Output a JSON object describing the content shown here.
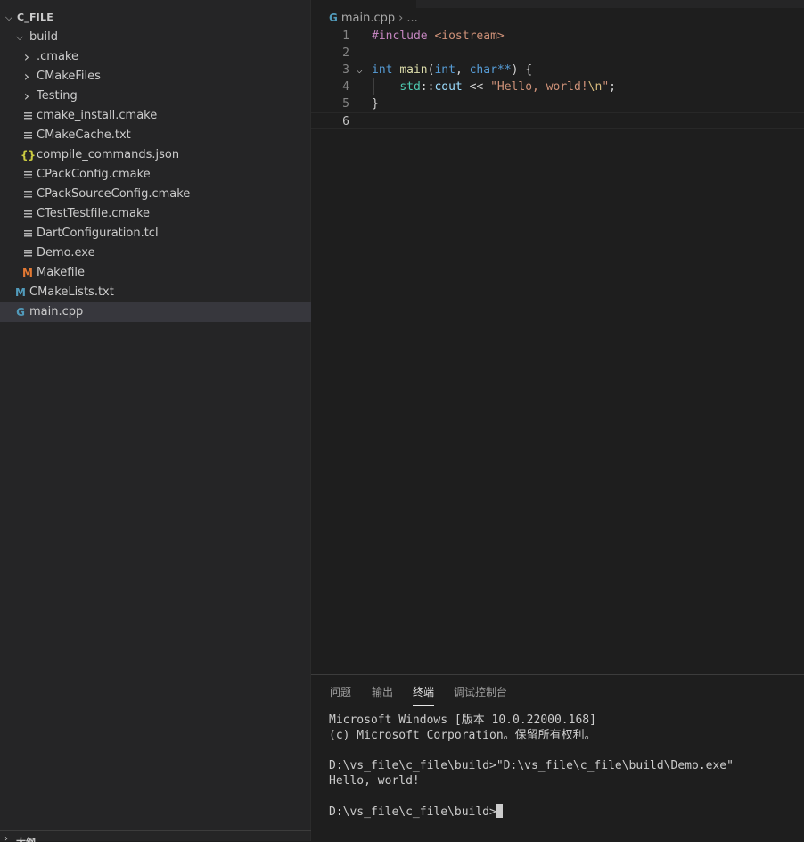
{
  "explorer": {
    "root": {
      "label": "C_FILE",
      "expanded": true
    },
    "items": [
      {
        "label": "build",
        "depth": 1,
        "kind": "folder",
        "expanded": true
      },
      {
        "label": ".cmake",
        "depth": 2,
        "kind": "folder",
        "expanded": false
      },
      {
        "label": "CMakeFiles",
        "depth": 2,
        "kind": "folder",
        "expanded": false
      },
      {
        "label": "Testing",
        "depth": 2,
        "kind": "folder",
        "expanded": false
      },
      {
        "label": "cmake_install.cmake",
        "depth": 2,
        "kind": "file",
        "icon": "file-lines-icon"
      },
      {
        "label": "CMakeCache.txt",
        "depth": 2,
        "kind": "file",
        "icon": "file-lines-icon"
      },
      {
        "label": "compile_commands.json",
        "depth": 2,
        "kind": "file",
        "icon": "json-braces-icon"
      },
      {
        "label": "CPackConfig.cmake",
        "depth": 2,
        "kind": "file",
        "icon": "file-lines-icon"
      },
      {
        "label": "CPackSourceConfig.cmake",
        "depth": 2,
        "kind": "file",
        "icon": "file-lines-icon"
      },
      {
        "label": "CTestTestfile.cmake",
        "depth": 2,
        "kind": "file",
        "icon": "file-lines-icon"
      },
      {
        "label": "DartConfiguration.tcl",
        "depth": 2,
        "kind": "file",
        "icon": "file-lines-icon"
      },
      {
        "label": "Demo.exe",
        "depth": 2,
        "kind": "file",
        "icon": "file-lines-icon"
      },
      {
        "label": "Makefile",
        "depth": 2,
        "kind": "file",
        "icon": "makefile-m-icon"
      },
      {
        "label": "CMakeLists.txt",
        "depth": 1,
        "kind": "file",
        "icon": "cmake-m-icon"
      },
      {
        "label": "main.cpp",
        "depth": 1,
        "kind": "file",
        "icon": "cpp-file-icon",
        "selected": true
      }
    ],
    "bottom_section_label": "大纲"
  },
  "editor": {
    "breadcrumb": {
      "file": "main.cpp",
      "rest": "..."
    },
    "lines": [
      {
        "num": "1",
        "tokens": [
          {
            "t": "#include ",
            "c": "tk-pre"
          },
          {
            "t": "<iostream>",
            "c": "tk-inc"
          }
        ]
      },
      {
        "num": "2",
        "tokens": []
      },
      {
        "num": "3",
        "fold": true,
        "tokens": [
          {
            "t": "int ",
            "c": "tk-type"
          },
          {
            "t": "main",
            "c": "tk-fn"
          },
          {
            "t": "(",
            "c": "tk-op"
          },
          {
            "t": "int",
            "c": "tk-type"
          },
          {
            "t": ", ",
            "c": "tk-op"
          },
          {
            "t": "char",
            "c": "tk-type"
          },
          {
            "t": "**",
            "c": "tk-type"
          },
          {
            "t": ") {",
            "c": "tk-op"
          }
        ]
      },
      {
        "num": "4",
        "guide": true,
        "tokens": [
          {
            "t": "    ",
            "c": "tk-op"
          },
          {
            "t": "std",
            "c": "tk-ns"
          },
          {
            "t": "::",
            "c": "tk-op"
          },
          {
            "t": "cout",
            "c": "tk-var"
          },
          {
            "t": " << ",
            "c": "tk-op"
          },
          {
            "t": "\"Hello, world!",
            "c": "tk-str"
          },
          {
            "t": "\\n",
            "c": "tk-esc"
          },
          {
            "t": "\"",
            "c": "tk-str"
          },
          {
            "t": ";",
            "c": "tk-op"
          }
        ]
      },
      {
        "num": "5",
        "tokens": [
          {
            "t": "}",
            "c": "tk-op"
          }
        ]
      },
      {
        "num": "6",
        "current": true,
        "tokens": []
      }
    ]
  },
  "panel": {
    "tabs": [
      {
        "label": "问题",
        "active": false
      },
      {
        "label": "输出",
        "active": false
      },
      {
        "label": "终端",
        "active": true
      },
      {
        "label": "调试控制台",
        "active": false
      }
    ],
    "terminal_lines": [
      "Microsoft Windows [版本 10.0.22000.168]",
      "(c) Microsoft Corporation。保留所有权利。",
      "",
      "D:\\vs_file\\c_file\\build>\"D:\\vs_file\\c_file\\build\\Demo.exe\"",
      "Hello, world!",
      ""
    ],
    "prompt": "D:\\vs_file\\c_file\\build>"
  },
  "colors": {
    "sidebar_bg": "#252526",
    "editor_bg": "#1e1e1e",
    "selected_row": "#37373d",
    "cpp_icon": "#519aba",
    "makefile_icon": "#e37933",
    "json_icon": "#cbcb41"
  }
}
